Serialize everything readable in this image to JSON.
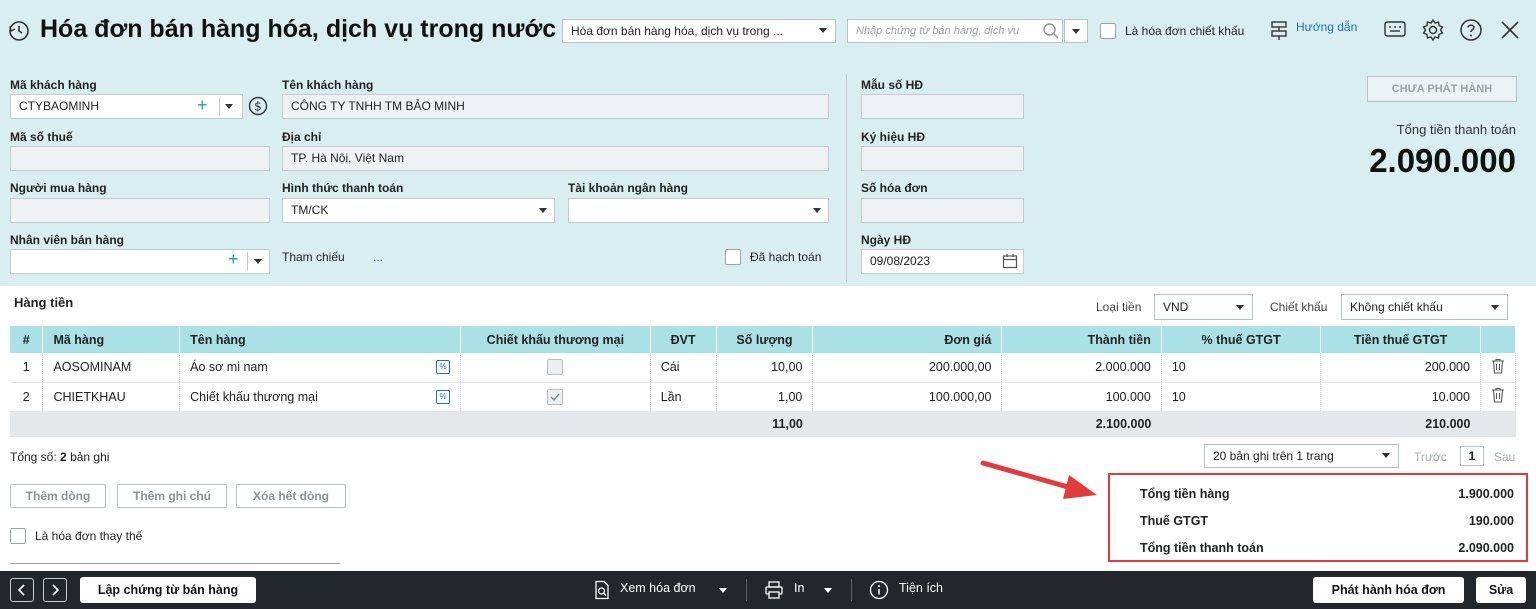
{
  "header": {
    "title": "Hóa đơn bán hàng hóa, dịch vụ trong nước",
    "type_select": "Hóa đơn bán hàng hóa, dịch vụ trong ...",
    "search_placeholder": "Nhập chứng từ bán hàng, dịch vụ",
    "discount_invoice_label": "Là hóa đơn chiết khấu",
    "guide_label": "Hướng dẫn"
  },
  "form": {
    "customer_code_label": "Mã khách hàng",
    "customer_code": "CTYBAOMINH",
    "customer_name_label": "Tên khách hàng",
    "customer_name": "CÔNG TY TNHH TM BẢO MINH",
    "tax_code_label": "Mã số thuế",
    "tax_code": "",
    "address_label": "Địa chỉ",
    "address": "TP. Hà Nội, Việt Nam",
    "buyer_label": "Người mua hàng",
    "buyer": "",
    "payment_method_label": "Hình thức thanh toán",
    "payment_method": "TM/CK",
    "bank_account_label": "Tài khoản ngân hàng",
    "bank_account": "",
    "sales_staff_label": "Nhân viên bán hàng",
    "sales_staff": "",
    "reference_label": "Tham chiếu",
    "reference_more": "...",
    "posted_label": "Đã hạch toán",
    "template_label": "Mẫu số HĐ",
    "template": "",
    "symbol_label": "Ký hiệu HĐ",
    "symbol": "",
    "invoice_no_label": "Số hóa đơn",
    "invoice_no": "",
    "invoice_date_label": "Ngày HĐ",
    "invoice_date": "09/08/2023"
  },
  "status": {
    "badge": "CHƯA PHÁT HÀNH",
    "total_label": "Tổng tiền thanh toán",
    "total_value": "2.090.000"
  },
  "items_section": {
    "title": "Hàng tiền",
    "currency_label": "Loại tiền",
    "currency": "VND",
    "discount_label": "Chiết khấu",
    "discount": "Không chiết khấu"
  },
  "table": {
    "headers": [
      "#",
      "Mã hàng",
      "Tên hàng",
      "Chiết khấu thương mại",
      "ĐVT",
      "Số lượng",
      "Đơn giá",
      "Thành tiền",
      "% thuế GTGT",
      "Tiền thuế GTGT"
    ],
    "rows": [
      {
        "no": "1",
        "code": "AOSOMINAM",
        "name": "Áo sơ mi nam",
        "discount_checked": false,
        "unit": "Cái",
        "qty": "10,00",
        "price": "200.000,00",
        "amount": "2.000.000",
        "vat_pct": "10",
        "vat_amount": "200.000"
      },
      {
        "no": "2",
        "code": "CHIETKHAU",
        "name": "Chiết khấu thương mại",
        "discount_checked": true,
        "unit": "Lần",
        "qty": "1,00",
        "price": "100.000,00",
        "amount": "100.000",
        "vat_pct": "10",
        "vat_amount": "10.000"
      }
    ],
    "totals": {
      "qty": "11,00",
      "amount": "2.100.000",
      "vat_amount": "210.000"
    }
  },
  "paging": {
    "total_prefix": "Tổng số:",
    "total_count": "2",
    "total_suffix": "bản ghi",
    "per_page": "20 bản ghi trên 1 trang",
    "prev": "Trước",
    "page": "1",
    "next": "Sau"
  },
  "actions": {
    "add_row": "Thêm dòng",
    "add_note": "Thêm ghi chú",
    "clear_rows": "Xóa hết dòng",
    "replacement_label": "Là hóa đơn thay thế"
  },
  "summary": {
    "goods_label": "Tổng tiền hàng",
    "goods_value": "1.900.000",
    "vat_label": "Thuế GTGT",
    "vat_value": "190.000",
    "pay_label": "Tổng tiền thanh toán",
    "pay_value": "2.090.000"
  },
  "footer": {
    "create_voucher": "Lập chứng từ bán hàng",
    "view_invoice": "Xem hóa đơn",
    "print": "In",
    "utilities": "Tiện ích",
    "issue_invoice": "Phát hành hóa đơn",
    "edit": "Sửa"
  },
  "colors": {
    "header_bg": "#d9eef0",
    "table_header_bg": "#a9e1e6",
    "footer_bg": "#23262a",
    "highlight_red": "#e23b3b",
    "link_blue": "#1a73c8"
  }
}
